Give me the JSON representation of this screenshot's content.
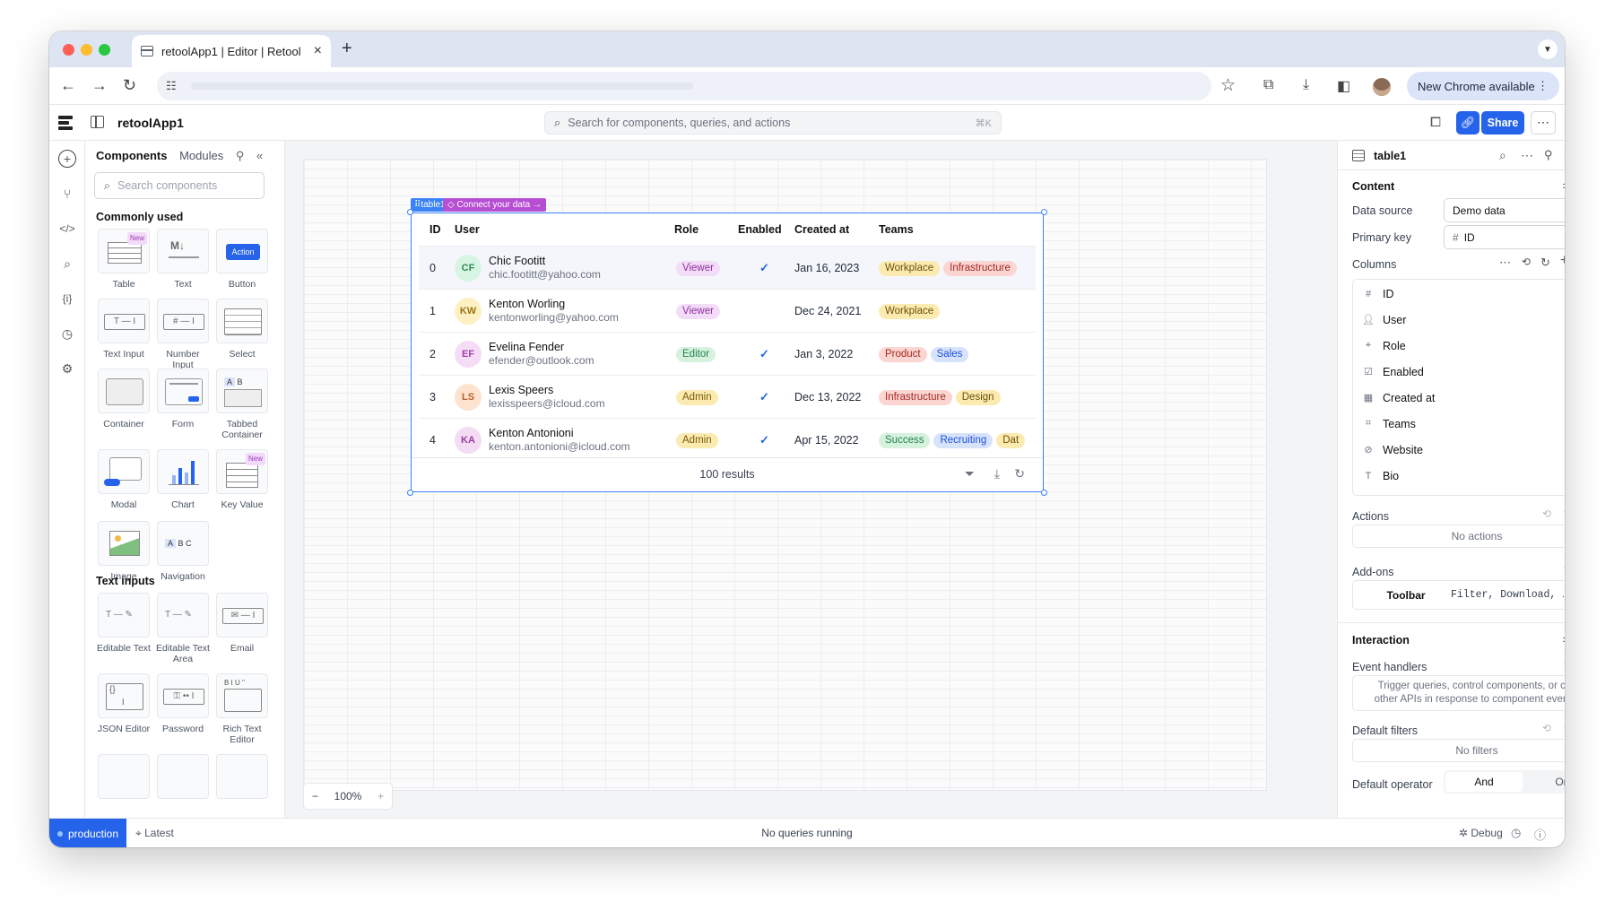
{
  "browser": {
    "tab_title": "retoolApp1 | Editor | Retool",
    "new_chrome": "New Chrome available"
  },
  "app": {
    "name": "retoolApp1",
    "search_placeholder": "Search for components, queries, and actions",
    "search_shortcut": "⌘K",
    "share_label": "Share"
  },
  "left_panel": {
    "tab_components": "Components",
    "tab_modules": "Modules",
    "search_placeholder": "Search components",
    "commonly_used": "Commonly used",
    "text_inputs": "Text inputs",
    "new_badge": "New",
    "action_badge": "Action",
    "items": [
      "Table",
      "Text",
      "Button",
      "Text Input",
      "Number Input",
      "Select",
      "Container",
      "Form",
      "Tabbed Container",
      "Modal",
      "Chart",
      "Key Value",
      "Image",
      "Navigation"
    ],
    "text_input_items": [
      "Editable Text",
      "Editable Text Area",
      "Email",
      "JSON Editor",
      "Password",
      "Rich Text Editor"
    ]
  },
  "canvas": {
    "zoom": "100%",
    "table_tag": "table1",
    "connect_tag": "Connect your data",
    "results": "100 results"
  },
  "table": {
    "headers": [
      "ID",
      "User",
      "Role",
      "Enabled",
      "Created at",
      "Teams"
    ],
    "rows": [
      {
        "id": "0",
        "initials": "CF",
        "name": "Chic Footitt",
        "email": "chic.footitt@yahoo.com",
        "role": "Viewer",
        "enabled": "✓",
        "created": "Jan 16, 2023",
        "teams": [
          "Workplace",
          "Infrastructure"
        ]
      },
      {
        "id": "1",
        "initials": "KW",
        "name": "Kenton Worling",
        "email": "kentonworling@yahoo.com",
        "role": "Viewer",
        "enabled": "",
        "created": "Dec 24, 2021",
        "teams": [
          "Workplace"
        ]
      },
      {
        "id": "2",
        "initials": "EF",
        "name": "Evelina Fender",
        "email": "efender@outlook.com",
        "role": "Editor",
        "enabled": "✓",
        "created": "Jan 3, 2022",
        "teams": [
          "Product",
          "Sales"
        ]
      },
      {
        "id": "3",
        "initials": "LS",
        "name": "Lexis Speers",
        "email": "lexisspeers@icloud.com",
        "role": "Admin",
        "enabled": "✓",
        "created": "Dec 13, 2022",
        "teams": [
          "Infrastructure",
          "Design"
        ]
      },
      {
        "id": "4",
        "initials": "KA",
        "name": "Kenton Antonioni",
        "email": "kenton.antonioni@icloud.com",
        "role": "Admin",
        "enabled": "✓",
        "created": "Apr 15, 2022",
        "teams": [
          "Success",
          "Recruiting",
          "Dat"
        ]
      }
    ]
  },
  "inspector": {
    "component": "table1",
    "content": "Content",
    "data_source_label": "Data source",
    "data_source_value": "Demo data",
    "primary_key_label": "Primary key",
    "primary_key_value": "ID",
    "columns_label": "Columns",
    "columns": [
      "ID",
      "User",
      "Role",
      "Enabled",
      "Created at",
      "Teams",
      "Website",
      "Bio"
    ],
    "actions_label": "Actions",
    "no_actions": "No actions",
    "addons_label": "Add-ons",
    "toolbar_label": "Toolbar",
    "toolbar_value": "Filter, Download, …",
    "interaction": "Interaction",
    "event_handlers": "Event handlers",
    "event_hint": "Trigger queries, control components, or call other APIs in response to component events.",
    "default_filters": "Default filters",
    "no_filters": "No filters",
    "default_operator": "Default operator",
    "op_and": "And",
    "op_or": "Or"
  },
  "status": {
    "env": "production",
    "latest": "Latest",
    "queries": "No queries running",
    "debug": "Debug"
  },
  "colors": {
    "accent": "#2563eb",
    "selection": "#3b82f6",
    "purple": "#b64fd2"
  }
}
